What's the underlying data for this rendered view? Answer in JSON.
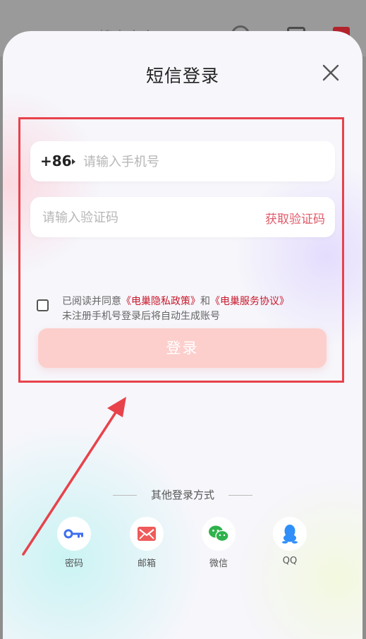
{
  "background": {
    "search_text": "搜索内容"
  },
  "modal": {
    "title": "短信登录",
    "close_icon": "close-icon"
  },
  "phone": {
    "country_code": "+86",
    "placeholder": "请输入手机号",
    "value": ""
  },
  "code": {
    "placeholder": "请输入验证码",
    "value": "",
    "get_code_label": "获取验证码"
  },
  "agreement": {
    "checked": false,
    "prefix": "已阅读并同意",
    "privacy_link": "《电巢隐私政策》",
    "and": "和",
    "service_link": "《电巢服务协议》",
    "note": "未注册手机号登录后将自动生成账号"
  },
  "login_button": "登录",
  "other_login": {
    "title": "其他登录方式",
    "methods": [
      {
        "label": "密码",
        "icon": "key-icon"
      },
      {
        "label": "邮箱",
        "icon": "mail-icon"
      },
      {
        "label": "微信",
        "icon": "wechat-icon"
      },
      {
        "label": "QQ",
        "icon": "qq-icon"
      }
    ]
  },
  "colors": {
    "highlight": "#e8424b",
    "link": "#c9182b",
    "accent": "#e05a6a",
    "login_button": "#fccfcc"
  }
}
